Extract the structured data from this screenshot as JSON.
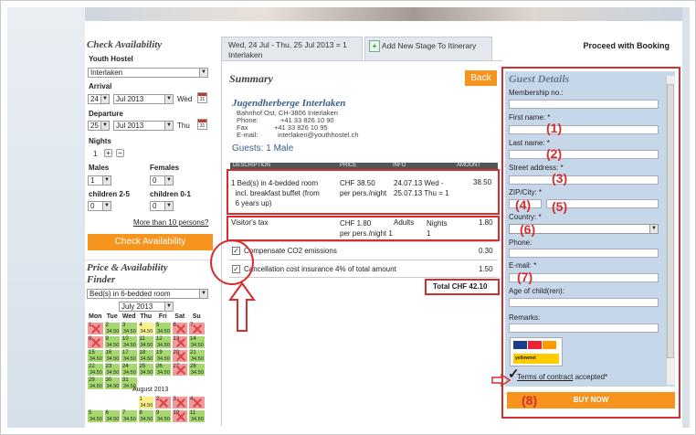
{
  "check_availability": {
    "title": "Check Availability",
    "hostel_label": "Youth Hostel",
    "hostel_value": "Interlaken",
    "arrival_label": "Arrival",
    "arrival_day": "24",
    "arrival_month": "Jul 2013",
    "arrival_weekday": "Wed",
    "departure_label": "Departure",
    "departure_day": "25",
    "departure_month": "Jul 2013",
    "departure_weekday": "Thu",
    "calendar_icon_text": "31",
    "nights_label": "Nights",
    "nights_value": "1",
    "males_label": "Males",
    "males_value": "1",
    "females_label": "Females",
    "females_value": "0",
    "children25_label": "children 2-5",
    "children25_value": "0",
    "children01_label": "children 0-1",
    "children01_value": "0",
    "more_link": "More than 10 persons?",
    "button": "Check Availability"
  },
  "finder": {
    "title_line1": "Price & Availability",
    "title_line2": "Finder",
    "room_value": "Bed(s) in 6-bedded room",
    "month_value": "July 2013",
    "weekdays": [
      "Mon",
      "Tue",
      "Wed",
      "Thu",
      "Fri",
      "Sat",
      "Su"
    ],
    "price": "34.50",
    "july_rows": [
      [
        {
          "n": "1",
          "c": "red",
          "x": true
        },
        {
          "n": "2",
          "c": "green",
          "p": "34.50"
        },
        {
          "n": "3",
          "c": "green",
          "p": "34.50"
        },
        {
          "n": "4",
          "c": "yellow",
          "p": "34.50"
        },
        {
          "n": "5",
          "c": "green",
          "p": "34.50"
        },
        {
          "n": "6",
          "c": "red",
          "x": true
        },
        {
          "n": "7",
          "c": "red",
          "x": true
        }
      ],
      [
        {
          "n": "8",
          "c": "red",
          "x": true
        },
        {
          "n": "9",
          "c": "green",
          "p": "34.50"
        },
        {
          "n": "10",
          "c": "green",
          "p": "34.50"
        },
        {
          "n": "11",
          "c": "green",
          "p": "34.50"
        },
        {
          "n": "12",
          "c": "green",
          "p": "34.50"
        },
        {
          "n": "13",
          "c": "red",
          "x": true
        },
        {
          "n": "14",
          "c": "green",
          "p": "34.50"
        }
      ],
      [
        {
          "n": "15",
          "c": "green",
          "p": "34.50"
        },
        {
          "n": "16",
          "c": "green",
          "p": "34.50"
        },
        {
          "n": "17",
          "c": "green",
          "p": "34.50"
        },
        {
          "n": "18",
          "c": "green",
          "p": "34.50"
        },
        {
          "n": "19",
          "c": "green",
          "p": "34.50"
        },
        {
          "n": "20",
          "c": "red",
          "x": true
        },
        {
          "n": "21",
          "c": "green",
          "p": "34.50"
        }
      ],
      [
        {
          "n": "22",
          "c": "green",
          "p": "34.50"
        },
        {
          "n": "23",
          "c": "green",
          "p": "34.50"
        },
        {
          "n": "24",
          "c": "green",
          "p": "34.50"
        },
        {
          "n": "25",
          "c": "green",
          "p": "34.50"
        },
        {
          "n": "26",
          "c": "green",
          "p": "34.50"
        },
        {
          "n": "27",
          "c": "red",
          "x": true
        },
        {
          "n": "28",
          "c": "green",
          "p": "34.50"
        }
      ],
      [
        {
          "n": "29",
          "c": "green",
          "p": "34.50"
        },
        {
          "n": "30",
          "c": "green",
          "p": "34.50"
        },
        {
          "n": "31",
          "c": "green",
          "p": "34.50"
        },
        {
          "n": "",
          "c": "none"
        },
        {
          "n": "",
          "c": "none"
        },
        {
          "n": "",
          "c": "none"
        },
        {
          "n": "",
          "c": "none"
        }
      ]
    ],
    "august_label": "August 2013",
    "aug_rows": [
      [
        {
          "n": "",
          "c": "none"
        },
        {
          "n": "",
          "c": "none"
        },
        {
          "n": "",
          "c": "none"
        },
        {
          "n": "1",
          "c": "yellow",
          "p": "34.50"
        },
        {
          "n": "2",
          "c": "red",
          "x": true
        },
        {
          "n": "3",
          "c": "red",
          "x": true
        },
        {
          "n": "4",
          "c": "red",
          "x": true
        }
      ],
      [
        {
          "n": "5",
          "c": "green",
          "p": "34.50"
        },
        {
          "n": "6",
          "c": "green",
          "p": "34.50"
        },
        {
          "n": "7",
          "c": "green",
          "p": "34.50"
        },
        {
          "n": "8",
          "c": "green",
          "p": "34.50"
        },
        {
          "n": "9",
          "c": "green",
          "p": "34.50"
        },
        {
          "n": "10",
          "c": "red",
          "x": true
        },
        {
          "n": "11",
          "c": "green",
          "p": "34.50"
        }
      ]
    ]
  },
  "tabs": {
    "stage": "Wed, 24 Jul - Thu, 25 Jul 2013 = 1",
    "stage_place": "Interlaken",
    "add_stage": "Add New Stage To Itinerary",
    "proceed": "Proceed with Booking"
  },
  "summary": {
    "title": "Summary",
    "back": "Back",
    "hostel_name": "Jugendherberge Interlaken",
    "address": "Bahnhof Ost, CH-3806 Interlaken",
    "phone_label": "Phone:",
    "phone": "+41 33 826 10 90",
    "fax_label": "Fax",
    "fax": "+41 33 826 10 95",
    "email_label": "E-mail:",
    "email": "interlaken@youthhostel.ch",
    "guests": "Guests: 1 Male",
    "col_desc": "DESCRIPTION",
    "col_price": "PRICE",
    "col_info": "INFO",
    "col_amount": "AMOUNT",
    "item1_desc_1": "1 Bed(s) in 4-bedded room",
    "item1_desc_2": "incl. breakfast buffet (from",
    "item1_desc_3": "6 years up)",
    "item1_price_1": "CHF 38.50",
    "item1_price_2": "per pers./night",
    "item1_info_1": "24.07.13 Wed -",
    "item1_info_2": "25.07.13 Thu = 1",
    "item1_amount": "38.50",
    "tax_desc": "Visitor's tax",
    "tax_price_1": "CHF 1.80",
    "tax_price_2": "per pers./night 1",
    "tax_info_1": "Adults",
    "tax_info_2": "Nights",
    "tax_info_3": "1",
    "tax_amount": "1.80",
    "co2_label": "Compensate CO2 emissions",
    "co2_amount": "0.30",
    "cancel_label": "Cancellation cost insurance 4% of total amount",
    "cancel_amount": "1.50",
    "total": "Total CHF 42.10"
  },
  "guest": {
    "title": "Guest Details",
    "membership": "Membership no.:",
    "first_name": "First name: *",
    "last_name": "Last name: *",
    "street": "Street address: *",
    "zip_city": "ZIP/City: *",
    "country": "Country: *",
    "phone": "Phone:",
    "email": "E-mail: *",
    "age_children": "Age of child(ren):",
    "remarks": "Remarks:",
    "terms_link": "Terms of contract",
    "terms_rest": " accepted*",
    "buy_now": "BUY NOW",
    "yellownet": "yellownet"
  },
  "annotations": [
    "(1)",
    "(2)",
    "(3)",
    "(4)",
    "(5)",
    "(6)",
    "(7)",
    "(8)"
  ],
  "colors": {
    "accent": "#f7941d",
    "annotation": "#d32f2f",
    "panel": "#c7d7ea"
  }
}
